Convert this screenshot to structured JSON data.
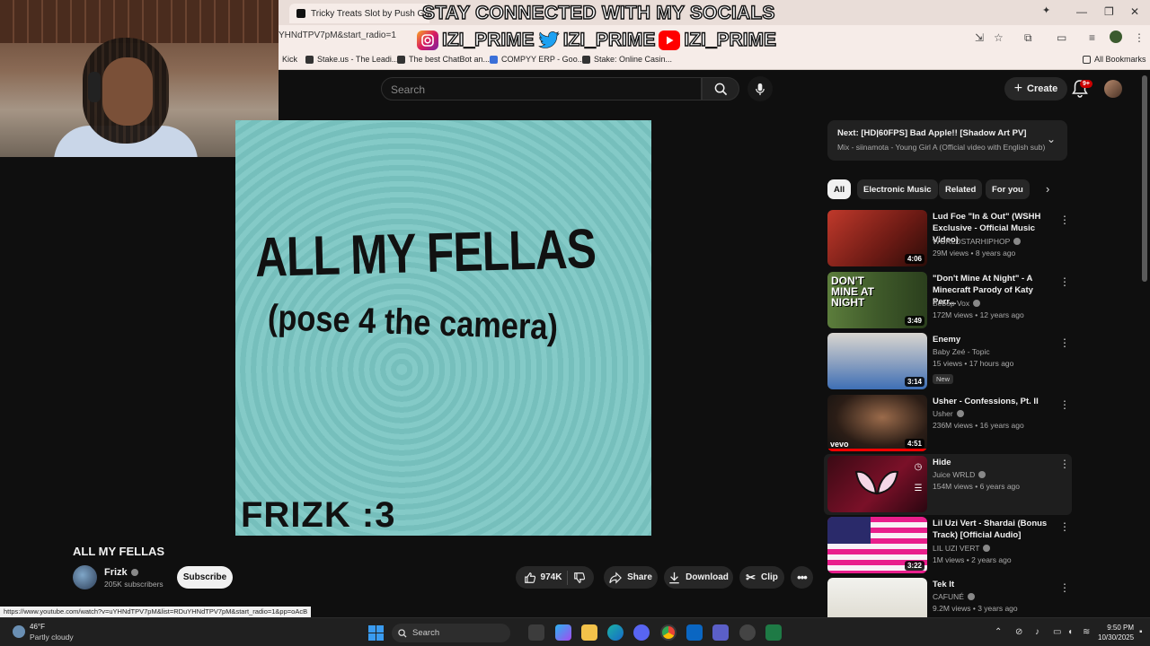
{
  "browser": {
    "tab_title": "Tricky Treats Slot by Push Gami",
    "url": "YHNdTPV7pM&start_radio=1",
    "bookmarks": [
      "Kick",
      "Stake.us - The Leadi...",
      "The best ChatBot an...",
      "COMPYY ERP - Goo...",
      "Stake: Online Casin..."
    ],
    "all_bookmarks": "All Bookmarks",
    "status_url": "https://www.youtube.com/watch?v=uYHNdTPV7pM&list=RDuYHNdTPV7pM&start_radio=1&pp=oAcB"
  },
  "overlay": {
    "line1": "STAY CONNECTED WITH MY SOCIALS",
    "handle": "IZI_PRIME"
  },
  "header": {
    "search_placeholder": "Search",
    "create_label": "Create",
    "notification_count": "9+"
  },
  "video": {
    "frame_line1": "ALL MY FELLAS",
    "frame_line2": "(pose 4 the camera)",
    "frame_line3": "FRIZK :3",
    "title": "ALL MY FELLAS",
    "channel": "Frizk",
    "subscribers": "205K subscribers",
    "subscribe_label": "Subscribe",
    "likes": "974K",
    "share_label": "Share",
    "download_label": "Download",
    "clip_label": "Clip"
  },
  "sidebar": {
    "next_title": "Next: [HD|60FPS] Bad Apple!! [Shadow Art PV]",
    "next_sub": "Mix - siinamota - Young Girl A (Official video with English sub)",
    "chips": [
      "All",
      "Electronic Music",
      "Related",
      "For you"
    ],
    "recs": [
      {
        "title": "Lud Foe \"In & Out\" (WSHH Exclusive - Official Music Video)",
        "channel": "WORLDSTARHIPHOP",
        "meta": "29M views • 8 years ago",
        "duration": "4:06"
      },
      {
        "title": "\"Don't Mine At Night\" - A Minecraft Parody of Katy Perr...",
        "channel": "Bebop Vox",
        "meta": "172M views • 12 years ago",
        "duration": "3:49",
        "thumb_text": "DON'T MINE AT NIGHT"
      },
      {
        "title": "Enemy",
        "channel": "Baby Zeé - Topic",
        "meta": "15 views • 17 hours ago",
        "badge": "New",
        "duration": "3:14"
      },
      {
        "title": "Usher - Confessions, Pt. II",
        "channel": "Usher",
        "meta": "236M views • 16 years ago",
        "duration": "4:51",
        "thumb_text": "vevo"
      },
      {
        "title": "Hide",
        "channel": "Juice WRLD",
        "meta": "154M views • 6 years ago"
      },
      {
        "title": "Lil Uzi Vert - Shardai (Bonus Track) [Official Audio]",
        "channel": "LIL UZI VERT",
        "meta": "1M views • 2 years ago",
        "duration": "3:22"
      },
      {
        "title": "Tek It",
        "channel": "CAFUNÉ",
        "meta": "9.2M views • 3 years ago"
      }
    ]
  },
  "taskbar": {
    "temp": "46°F",
    "weather": "Partly cloudy",
    "search_label": "Search",
    "time": "9:50 PM",
    "date": "10/30/2025"
  }
}
